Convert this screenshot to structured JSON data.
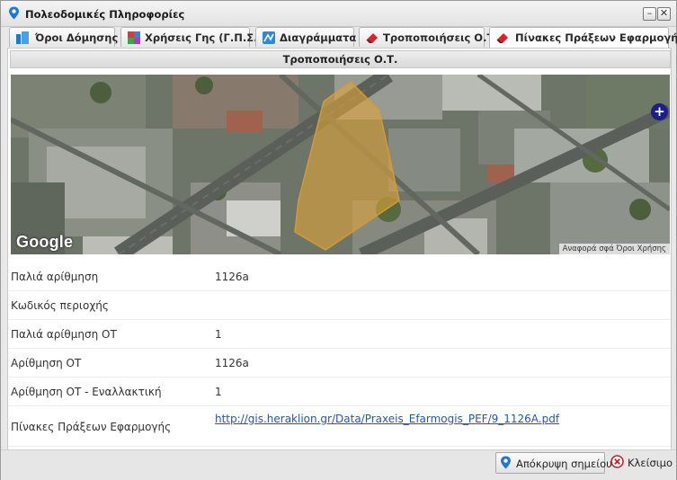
{
  "window": {
    "title": "Πολεοδομικές Πληροφορίες",
    "minimize_glyph": "–",
    "close_glyph": "✕"
  },
  "tabs": [
    {
      "label": "Όροι Δόμησης",
      "icon": "building-terms-icon",
      "active": false
    },
    {
      "label": "Χρήσεις Γης (Γ.Π.Σ.)",
      "icon": "land-use-icon",
      "active": false
    },
    {
      "label": "Διαγράμματα",
      "icon": "diagram-icon",
      "active": false
    },
    {
      "label": "Τροποποιήσεις Ο.Τ.",
      "icon": "eraser-icon",
      "active": false
    },
    {
      "label": "Πίνακες Πράξεων Εφαρμογής",
      "icon": "eraser-icon",
      "active": true
    }
  ],
  "section": {
    "title": "Τροποποιήσεις Ο.Τ."
  },
  "map": {
    "logo_text": "Google",
    "attribution": "Αναφορά σφά  Όροι Χρήσης",
    "add_glyph": "+",
    "highlight_color": "#e0a43a"
  },
  "details": [
    {
      "label": "Παλιά αρίθμηση",
      "value": "1126a"
    },
    {
      "label": "Κωδικός περιοχής",
      "value": ""
    },
    {
      "label": "Παλιά αρίθμηση ΟΤ",
      "value": "1"
    },
    {
      "label": "Αρίθμηση ΟΤ",
      "value": "1126a"
    },
    {
      "label": "Αρίθμηση ΟΤ - Εναλλακτική",
      "value": "1"
    },
    {
      "label": "Πίνακες Πράξεων Εφαρμογής",
      "value": "http://gis.heraklion.gr/Data/Praxeis_Efarmogis_PEF/9_1126A.pdf"
    }
  ],
  "footer": {
    "hide_marker_label": "Απόκρυψη σημείου",
    "close_label": "Κλείσιμο"
  },
  "colors": {
    "accent": "#1f79d0",
    "link": "#2554b8",
    "close_red": "#c8222a"
  }
}
